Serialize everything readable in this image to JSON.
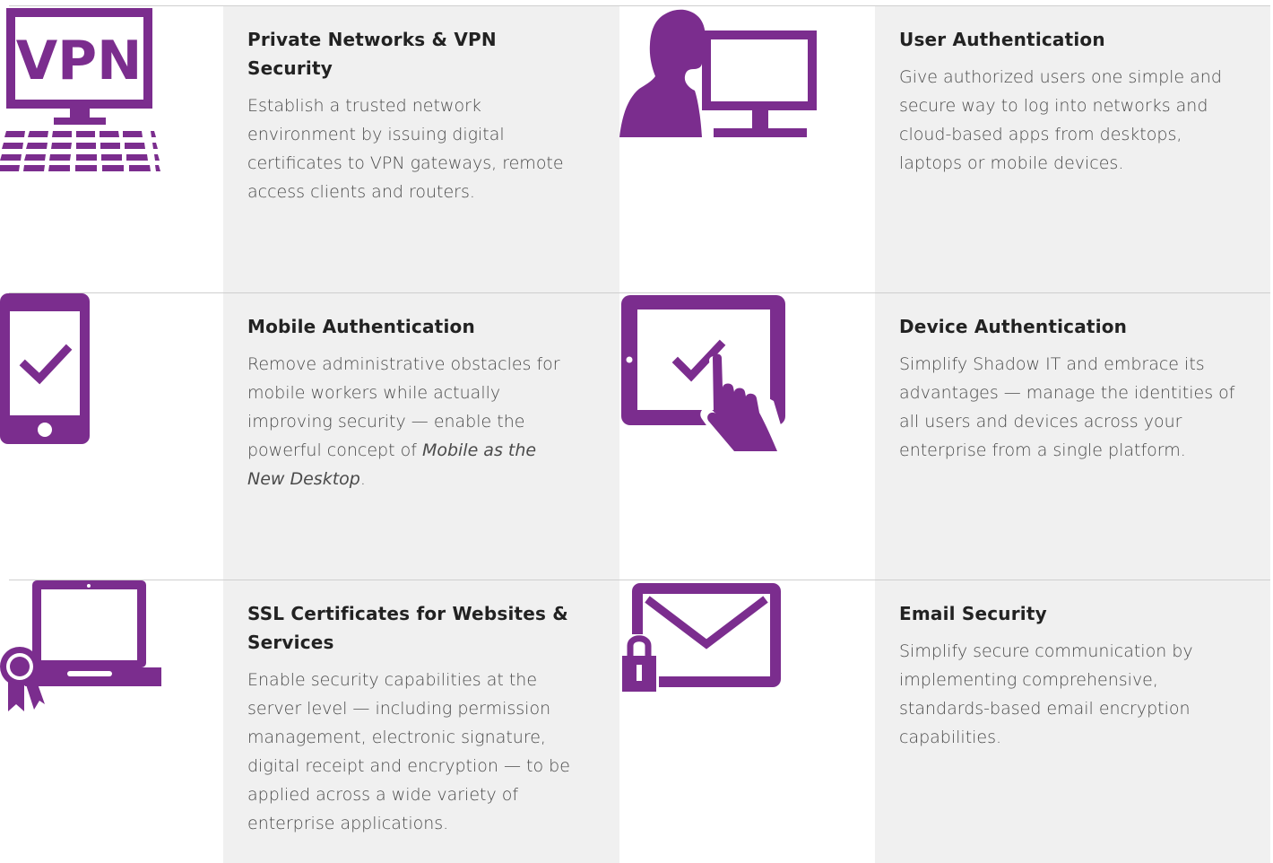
{
  "theme": {
    "accent": "#7b2d8e",
    "text_panel_bg": "#f0f0f0",
    "divider": "#cfcfcf"
  },
  "features": [
    {
      "icon": "vpn-computer-icon",
      "title": "Private Networks & VPN Security",
      "description": "Establish a trusted network environment by issuing digital certificates to VPN gateways, remote access clients and routers.",
      "icon_text": "VPN"
    },
    {
      "icon": "user-at-monitor-icon",
      "title": "User Authentication",
      "description": "Give authorized users one simple and secure way to log into networks and cloud-based apps from desktops, laptops or mobile devices."
    },
    {
      "icon": "mobile-checkmark-icon",
      "title": "Mobile Authentication",
      "description_before": "Remove administrative obstacles for mobile workers while actually improving security — enable the powerful concept of ",
      "description_emphasis": "Mobile as the New Desktop",
      "description_after": "."
    },
    {
      "icon": "tablet-touch-checkmark-icon",
      "title": "Device Authentication",
      "description": "Simplify Shadow IT and embrace its advantages — manage the identities of all users and devices across your enterprise from a single platform."
    },
    {
      "icon": "laptop-certificate-icon",
      "title": "SSL Certificates for Websites & Services",
      "description": "Enable security capabilities at the server level — including permission management, electronic signature, digital receipt and encryption — to be applied across a wide variety of enterprise applications."
    },
    {
      "icon": "envelope-lock-icon",
      "title": "Email Security",
      "description": "Simplify secure communication by implementing comprehensive, standards-based email encryption capabilities."
    }
  ]
}
